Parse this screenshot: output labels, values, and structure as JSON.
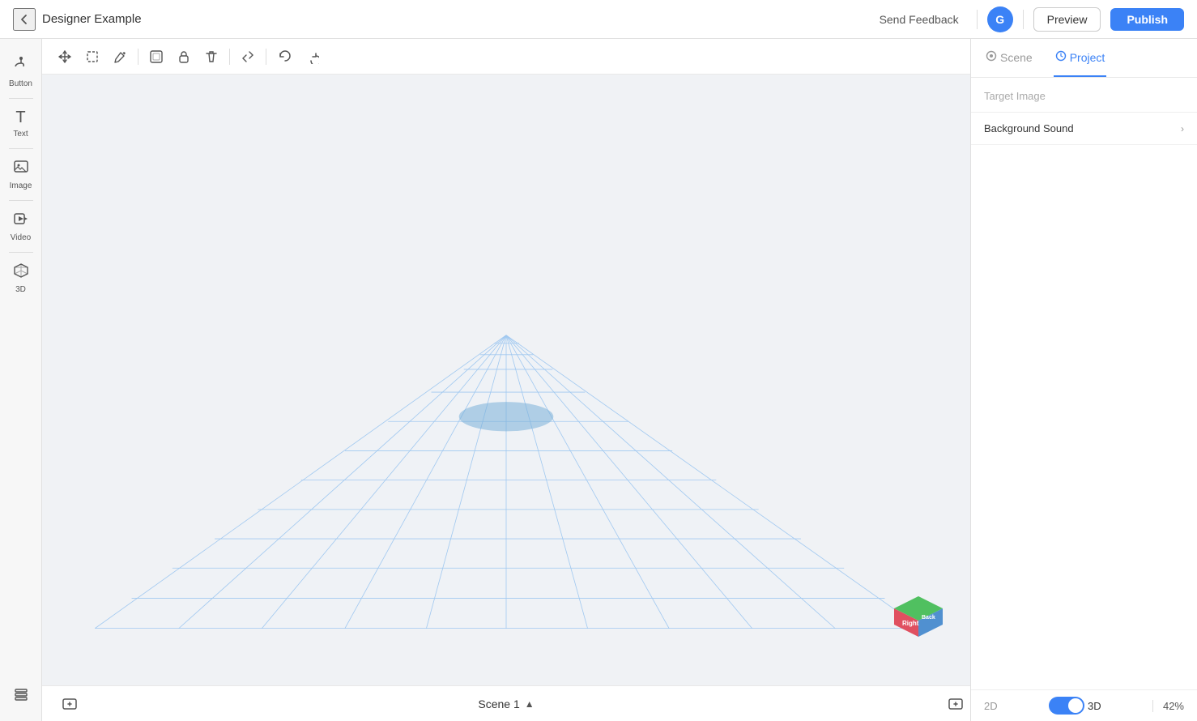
{
  "header": {
    "back_label": "←",
    "title": "Designer Example",
    "send_feedback": "Send Feedback",
    "avatar_letter": "G",
    "preview_label": "Preview",
    "publish_label": "Publish"
  },
  "sidebar": {
    "items": [
      {
        "id": "button",
        "icon": "☞",
        "label": "Button"
      },
      {
        "id": "text",
        "icon": "T",
        "label": "Text"
      },
      {
        "id": "image",
        "icon": "🖼",
        "label": "Image"
      },
      {
        "id": "video",
        "icon": "▶",
        "label": "Video"
      },
      {
        "id": "3d",
        "icon": "⬡",
        "label": "3D"
      }
    ],
    "layers_label": "Layers",
    "layers_icon": "⊞"
  },
  "toolbar": {
    "buttons": [
      {
        "id": "move",
        "icon": "⊕"
      },
      {
        "id": "select",
        "icon": "⬜"
      },
      {
        "id": "pen",
        "icon": "✏"
      },
      {
        "id": "frame",
        "icon": "⊡"
      },
      {
        "id": "lock",
        "icon": "🔒"
      },
      {
        "id": "delete",
        "icon": "🗑"
      },
      {
        "id": "collapse",
        "icon": "⤢"
      },
      {
        "id": "undo",
        "icon": "↩"
      },
      {
        "id": "redo",
        "icon": "↪"
      }
    ]
  },
  "right_panel": {
    "tabs": [
      {
        "id": "scene",
        "label": "Scene",
        "icon": "◎",
        "active": false
      },
      {
        "id": "project",
        "label": "Project",
        "icon": "⚙",
        "active": true
      }
    ],
    "target_image_label": "Target Image",
    "background_sound_label": "Background Sound",
    "expand_icon": "›"
  },
  "bottom_bar": {
    "add_scene_label": "+",
    "scene_label": "Scene 1",
    "chevron": "∧",
    "add_right_label": "+"
  },
  "view_toggle": {
    "label_2d": "2D",
    "label_3d": "3D",
    "zoom": "42%"
  },
  "colors": {
    "accent": "#3b82f6",
    "grid_line": "#a8c8f0",
    "grid_bg": "#f0f4fa",
    "ellipse": "#7ab0e0"
  }
}
